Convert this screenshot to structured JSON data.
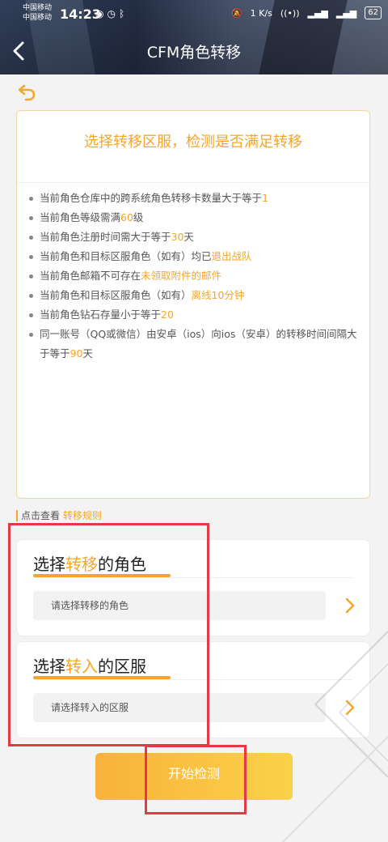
{
  "status_bar": {
    "carrier_1": "中国移动",
    "carrier_2": "中国移动",
    "time": "14:23",
    "net_speed": "1 K/s",
    "battery": "62"
  },
  "nav": {
    "title": "CFM角色转移"
  },
  "conditions": {
    "title": "选择转移区服，检测是否满足转移",
    "items": [
      {
        "pre": "当前角色仓库中的跨系统角色转移卡数量大于等于",
        "hl": "1",
        "post": ""
      },
      {
        "pre": "当前角色等级需满",
        "hl": "60",
        "post": "级"
      },
      {
        "pre": "当前角色注册时间需大于等于",
        "hl": "30",
        "post": "天"
      },
      {
        "pre": "当前角色和目标区服角色（如有）均已",
        "hl": "退出战队",
        "post": ""
      },
      {
        "pre": "当前角色邮箱不可存在",
        "hl": "未领取附件的邮件",
        "post": ""
      },
      {
        "pre": "当前角色和目标区服角色（如有）",
        "hl": "离线10分钟",
        "post": ""
      },
      {
        "pre": "当前角色钻石存量小于等于",
        "hl": "20",
        "post": ""
      },
      {
        "pre": "同一账号（QQ或微信）由安卓（ios）向ios（安卓）的转移时间间隔大于等于",
        "hl": "90",
        "post": "天"
      }
    ]
  },
  "rules": {
    "prefix": "点击查看",
    "link": "转移规则"
  },
  "select_role": {
    "title_pre": "选择",
    "title_accent": "转移",
    "title_post": "的角色",
    "placeholder": "请选择转移的角色"
  },
  "select_server": {
    "title_pre": "选择",
    "title_accent": "转入",
    "title_post": "的区服",
    "placeholder": "请选择转入的区服"
  },
  "start_button": {
    "label": "开始检测"
  },
  "colors": {
    "accent": "#f4a62a",
    "highlight_box": "#e23a46"
  }
}
